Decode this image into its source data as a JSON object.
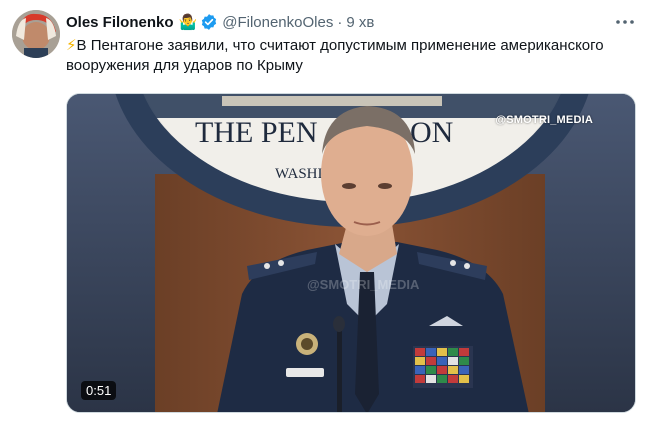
{
  "author": {
    "name": "Oles Filonenko",
    "badge_emoji": "🤷‍♂️",
    "handle": "@FilonenkoOles",
    "separator": "·",
    "time": "9 хв",
    "verified": true
  },
  "tweet": {
    "bolt": "⚡",
    "text": "В Пентагоне заявили, что считают допустимым применение американского вооружения для ударов по Крыму"
  },
  "media": {
    "watermark": "@SMOTRI_MEDIA",
    "watermark_center": "@SMOTRI_MEDIA",
    "seal_text": "THE PENTAGON",
    "seal_visible_text": "THE PEN",
    "seal_visible_text_2": "ON",
    "seal_subtext": "WASHI",
    "duration": "0:51"
  },
  "icons": {
    "verified": "verified-badge-icon",
    "more": "more-options-icon"
  },
  "colors": {
    "accent": "#1d9bf0",
    "text_primary": "#0f1419",
    "text_secondary": "#536471"
  }
}
